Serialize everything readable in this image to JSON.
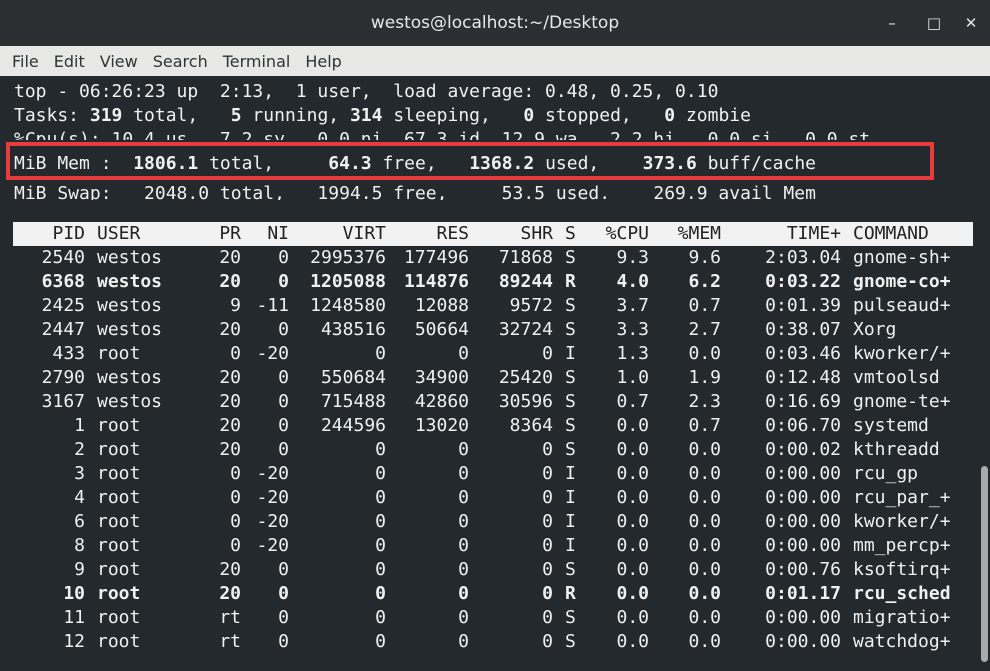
{
  "window": {
    "title": "westos@localhost:~/Desktop",
    "minimize_glyph": "–",
    "maximize_glyph": "□",
    "close_glyph": "✕"
  },
  "menu": [
    "File",
    "Edit",
    "View",
    "Search",
    "Terminal",
    "Help"
  ],
  "summary": {
    "top_line": "top - 06:26:23 up  2:13,  1 user,  load average: 0.48, 0.25, 0.10",
    "tasks_label": "Tasks: ",
    "tasks_total": "319",
    "tasks_total_label": " total,   ",
    "tasks_running": "5",
    "tasks_running_label": " running, ",
    "tasks_sleeping": "314",
    "tasks_sleeping_label": " sleeping,   ",
    "tasks_stopped": "0",
    "tasks_stopped_label": " stopped,   ",
    "tasks_zombie": "0",
    "tasks_zombie_label": " zombie",
    "cpu_line": "%Cpu(s): 10.4 us,  7.2 sy,  0.0 ni, 67.3 id, 12.9 wa,  2.2 hi,  0.0 si,  0.0 st",
    "mem_label": "MiB Mem :  ",
    "mem_total": "1806.1",
    "mem_total_label": " total,     ",
    "mem_free": "64.3",
    "mem_free_label": " free,   ",
    "mem_used": "1368.2",
    "mem_used_label": " used,    ",
    "mem_cache": "373.6",
    "mem_cache_label": " buff/cache",
    "swap_line": "MiB Swap:   2048.0 total,   1994.5 free,     53.5 used.    269.9 avail Mem"
  },
  "table": {
    "headers": [
      "PID",
      "USER",
      "PR",
      "NI",
      "VIRT",
      "RES",
      "SHR",
      "S",
      "%CPU",
      "%MEM",
      "TIME+",
      "COMMAND"
    ],
    "rows": [
      [
        "2540",
        "westos",
        "20",
        "0",
        "2995376",
        "177496",
        "71868",
        "S",
        "9.3",
        "9.6",
        "2:03.04",
        "gnome-sh+"
      ],
      [
        "6368",
        "westos",
        "20",
        "0",
        "1205088",
        "114876",
        "89244",
        "R",
        "4.0",
        "6.2",
        "0:03.22",
        "gnome-co+"
      ],
      [
        "2425",
        "westos",
        "9",
        "-11",
        "1248580",
        "12088",
        "9572",
        "S",
        "3.7",
        "0.7",
        "0:01.39",
        "pulseaud+"
      ],
      [
        "2447",
        "westos",
        "20",
        "0",
        "438516",
        "50664",
        "32724",
        "S",
        "3.3",
        "2.7",
        "0:38.07",
        "Xorg"
      ],
      [
        "433",
        "root",
        "0",
        "-20",
        "0",
        "0",
        "0",
        "I",
        "1.3",
        "0.0",
        "0:03.46",
        "kworker/+"
      ],
      [
        "2790",
        "westos",
        "20",
        "0",
        "550684",
        "34900",
        "25420",
        "S",
        "1.0",
        "1.9",
        "0:12.48",
        "vmtoolsd"
      ],
      [
        "3167",
        "westos",
        "20",
        "0",
        "715488",
        "42860",
        "30596",
        "S",
        "0.7",
        "2.3",
        "0:16.69",
        "gnome-te+"
      ],
      [
        "1",
        "root",
        "20",
        "0",
        "244596",
        "13020",
        "8364",
        "S",
        "0.0",
        "0.7",
        "0:06.70",
        "systemd"
      ],
      [
        "2",
        "root",
        "20",
        "0",
        "0",
        "0",
        "0",
        "S",
        "0.0",
        "0.0",
        "0:00.02",
        "kthreadd"
      ],
      [
        "3",
        "root",
        "0",
        "-20",
        "0",
        "0",
        "0",
        "I",
        "0.0",
        "0.0",
        "0:00.00",
        "rcu_gp"
      ],
      [
        "4",
        "root",
        "0",
        "-20",
        "0",
        "0",
        "0",
        "I",
        "0.0",
        "0.0",
        "0:00.00",
        "rcu_par_+"
      ],
      [
        "6",
        "root",
        "0",
        "-20",
        "0",
        "0",
        "0",
        "I",
        "0.0",
        "0.0",
        "0:00.00",
        "kworker/+"
      ],
      [
        "8",
        "root",
        "0",
        "-20",
        "0",
        "0",
        "0",
        "I",
        "0.0",
        "0.0",
        "0:00.00",
        "mm_percp+"
      ],
      [
        "9",
        "root",
        "20",
        "0",
        "0",
        "0",
        "0",
        "S",
        "0.0",
        "0.0",
        "0:00.76",
        "ksoftirq+"
      ],
      [
        "10",
        "root",
        "20",
        "0",
        "0",
        "0",
        "0",
        "R",
        "0.0",
        "0.0",
        "0:01.17",
        "rcu_sched"
      ],
      [
        "11",
        "root",
        "rt",
        "0",
        "0",
        "0",
        "0",
        "S",
        "0.0",
        "0.0",
        "0:00.00",
        "migratio+"
      ],
      [
        "12",
        "root",
        "rt",
        "0",
        "0",
        "0",
        "0",
        "S",
        "0.0",
        "0.0",
        "0:00.00",
        "watchdog+"
      ]
    ],
    "bold_rows": [
      1,
      14
    ]
  },
  "colors": {
    "terminal_bg": "#23292c",
    "terminal_fg": "#f0f0f0",
    "highlight": "#e83b3d",
    "header_bg": "#f2f2f2"
  }
}
